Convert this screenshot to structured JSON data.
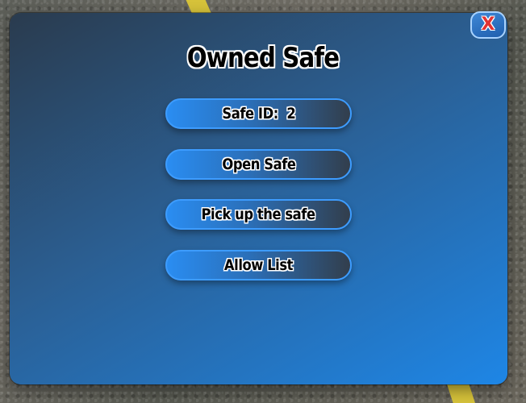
{
  "dialog": {
    "title": "Owned Safe",
    "close_label": "X"
  },
  "buttons": [
    {
      "label": "Safe ID:  2"
    },
    {
      "label": "Open Safe"
    },
    {
      "label": "Pick up the safe"
    },
    {
      "label": "Allow List"
    }
  ],
  "colors": {
    "panel_start": "#2a3b4e",
    "panel_end": "#1e86e6",
    "button_accent": "#3d9cff",
    "close_x": "#e23232",
    "road_line": "#d6c23a"
  }
}
